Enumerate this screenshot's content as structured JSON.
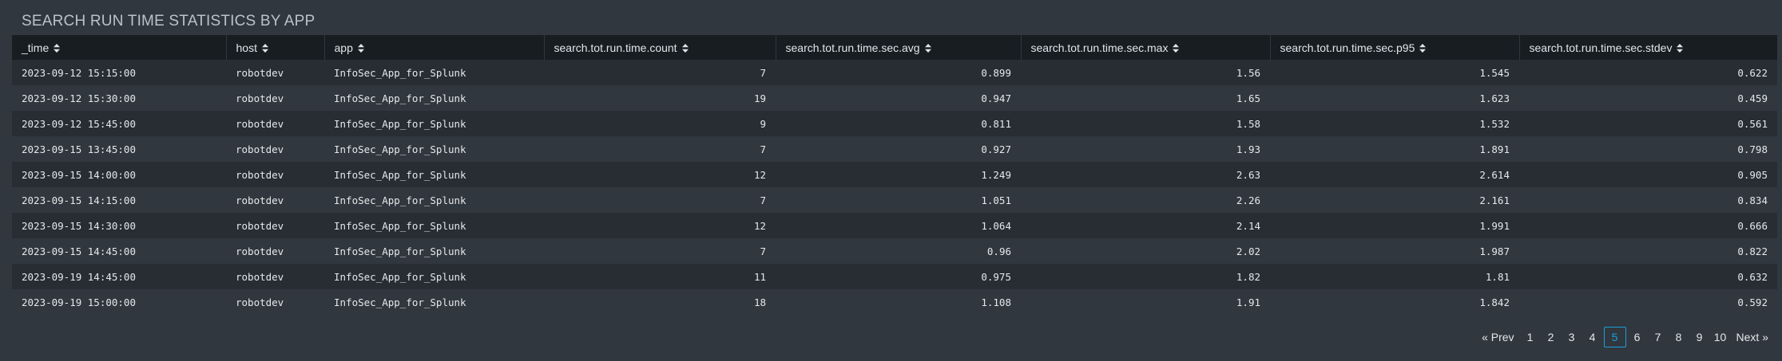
{
  "panel": {
    "title": "SEARCH RUN TIME STATISTICS BY APP"
  },
  "table": {
    "columns": [
      {
        "label": "_time",
        "align": "left"
      },
      {
        "label": "host",
        "align": "left"
      },
      {
        "label": "app",
        "align": "left"
      },
      {
        "label": "search.tot.run.time.count",
        "align": "right"
      },
      {
        "label": "search.tot.run.time.sec.avg",
        "align": "right"
      },
      {
        "label": "search.tot.run.time.sec.max",
        "align": "right"
      },
      {
        "label": "search.tot.run.time.sec.p95",
        "align": "right"
      },
      {
        "label": "search.tot.run.time.sec.stdev",
        "align": "right"
      }
    ],
    "sort_icon": "sort-arrows-icon",
    "rows": [
      [
        "2023-09-12 15:15:00",
        "robotdev",
        "InfoSec_App_for_Splunk",
        "7",
        "0.899",
        "1.56",
        "1.545",
        "0.622"
      ],
      [
        "2023-09-12 15:30:00",
        "robotdev",
        "InfoSec_App_for_Splunk",
        "19",
        "0.947",
        "1.65",
        "1.623",
        "0.459"
      ],
      [
        "2023-09-12 15:45:00",
        "robotdev",
        "InfoSec_App_for_Splunk",
        "9",
        "0.811",
        "1.58",
        "1.532",
        "0.561"
      ],
      [
        "2023-09-15 13:45:00",
        "robotdev",
        "InfoSec_App_for_Splunk",
        "7",
        "0.927",
        "1.93",
        "1.891",
        "0.798"
      ],
      [
        "2023-09-15 14:00:00",
        "robotdev",
        "InfoSec_App_for_Splunk",
        "12",
        "1.249",
        "2.63",
        "2.614",
        "0.905"
      ],
      [
        "2023-09-15 14:15:00",
        "robotdev",
        "InfoSec_App_for_Splunk",
        "7",
        "1.051",
        "2.26",
        "2.161",
        "0.834"
      ],
      [
        "2023-09-15 14:30:00",
        "robotdev",
        "InfoSec_App_for_Splunk",
        "12",
        "1.064",
        "2.14",
        "1.991",
        "0.666"
      ],
      [
        "2023-09-15 14:45:00",
        "robotdev",
        "InfoSec_App_for_Splunk",
        "7",
        "0.96",
        "2.02",
        "1.987",
        "0.822"
      ],
      [
        "2023-09-19 14:45:00",
        "robotdev",
        "InfoSec_App_for_Splunk",
        "11",
        "0.975",
        "1.82",
        "1.81",
        "0.632"
      ],
      [
        "2023-09-19 15:00:00",
        "robotdev",
        "InfoSec_App_for_Splunk",
        "18",
        "1.108",
        "1.91",
        "1.842",
        "0.592"
      ]
    ]
  },
  "pagination": {
    "prev_label": "« Prev",
    "next_label": "Next »",
    "pages": [
      "1",
      "2",
      "3",
      "4",
      "5",
      "6",
      "7",
      "8",
      "9",
      "10"
    ],
    "current_page": "5"
  },
  "colors": {
    "background": "#31373e",
    "header_background": "#171d21",
    "row_alt": "#272d33",
    "accent": "#1a9fd8"
  }
}
